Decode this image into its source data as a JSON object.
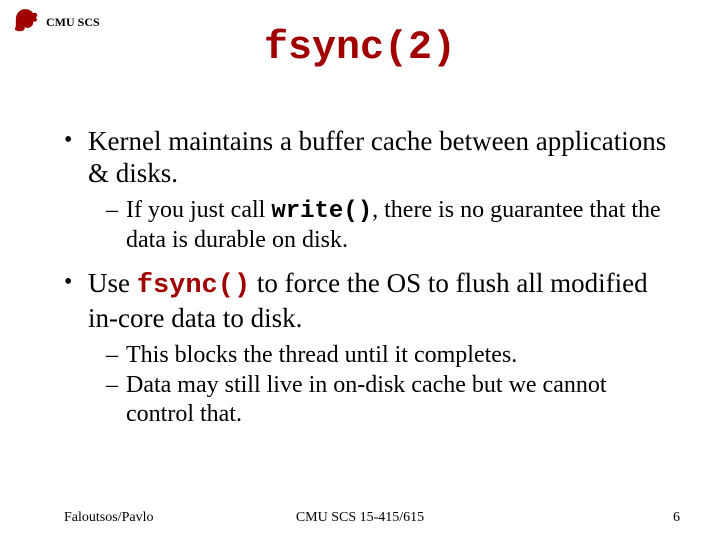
{
  "header": {
    "label": "CMU SCS"
  },
  "title": "fsync(2)",
  "bullets": [
    {
      "text_pre": "Kernel maintains a buffer cache between applications & disks.",
      "sub": [
        {
          "pre": "If you just call ",
          "code": "write()",
          "post": ", there is no guarantee that the data is durable on disk."
        }
      ]
    },
    {
      "pre": "Use ",
      "code": "fsync()",
      "post": " to force the OS to flush all modified in-core data to disk.",
      "sub": [
        {
          "text": "This blocks the thread until it completes."
        },
        {
          "text": "Data may still live in on-disk cache but we cannot control that."
        }
      ]
    }
  ],
  "footer": {
    "left": "Faloutsos/Pavlo",
    "center": "CMU SCS 15-415/615",
    "right": "6"
  },
  "colors": {
    "accent": "#a00000"
  }
}
